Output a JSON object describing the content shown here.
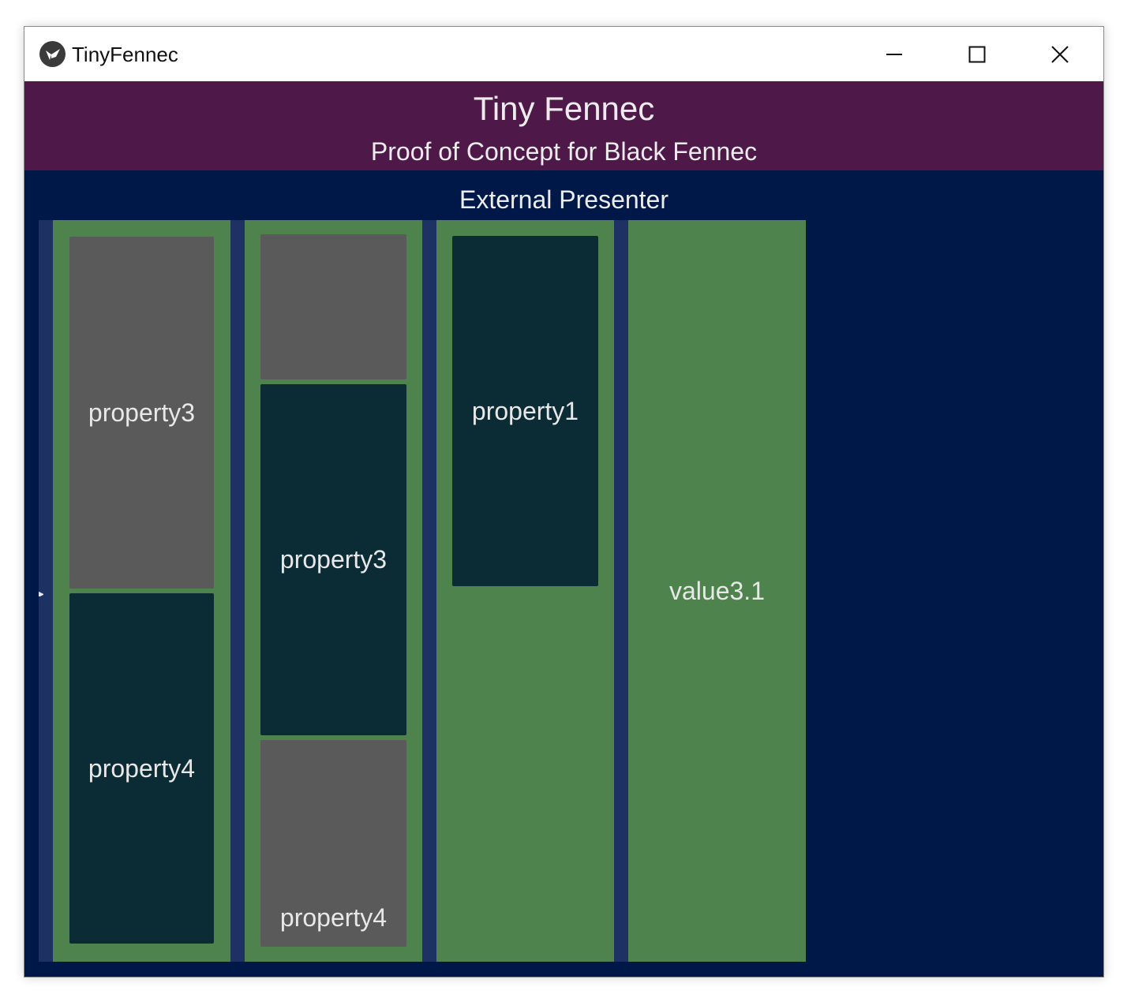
{
  "window": {
    "title": "TinyFennec",
    "controls": {
      "minimize": "minimize-icon",
      "maximize": "maximize-icon",
      "close": "close-icon"
    }
  },
  "header": {
    "title": "Tiny Fennec",
    "subtitle": "Proof of Concept for Black Fennec"
  },
  "presenter": {
    "label": "External Presenter",
    "columns": [
      {
        "items": [
          "property3",
          "property4"
        ]
      },
      {
        "items": [
          "",
          "property3",
          "property4"
        ]
      },
      {
        "items": [
          "property1"
        ]
      },
      {
        "items": [
          "value3.1"
        ]
      }
    ]
  },
  "colors": {
    "header_bg": "#4e1849",
    "content_bg": "#001848",
    "column_bg": "#4f834e",
    "cell_gray": "#5a5a5a",
    "cell_dark": "#0b2c34"
  }
}
